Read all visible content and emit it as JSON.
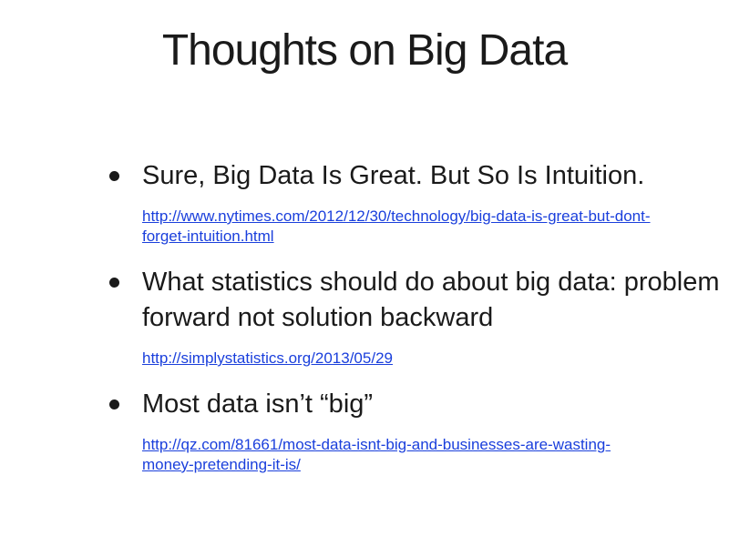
{
  "slide": {
    "title": "Thoughts on Big Data",
    "bullets": [
      {
        "text": "Sure, Big Data Is Great. But So Is Intuition.",
        "link": "http://www.nytimes.com/2012/12/30/technology/big-data-is-great-but-dont-forget-intuition.html"
      },
      {
        "text": "What statistics should do about big data: problem forward not solution backward",
        "link": "http://simplystatistics.org/2013/05/29"
      },
      {
        "text": "Most data isn’t “big”",
        "link": "http://qz.com/81661/most-data-isnt-big-and-businesses-are-wasting-money-pretending-it-is/"
      }
    ]
  },
  "colors": {
    "text": "#1a1a1a",
    "link": "#1a3fdc",
    "background": "#ffffff"
  }
}
